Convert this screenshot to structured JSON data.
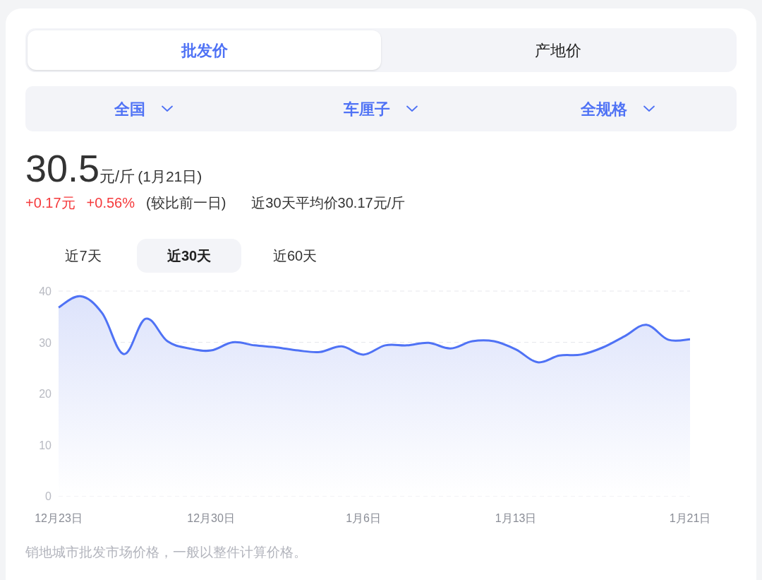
{
  "price_tabs": [
    {
      "label": "批发价",
      "selected": true
    },
    {
      "label": "产地价",
      "selected": false
    }
  ],
  "filters": [
    {
      "label": "全国"
    },
    {
      "label": "车厘子"
    },
    {
      "label": "全规格"
    }
  ],
  "price": {
    "value": "30.5",
    "unit": "元/斤",
    "date": "(1月21日)"
  },
  "change": {
    "amount": "+0.17元",
    "percent": "+0.56%",
    "note": "(较比前一日)",
    "average": "近30天平均价30.17元/斤"
  },
  "range_tabs": [
    {
      "label": "近7天",
      "selected": false
    },
    {
      "label": "近30天",
      "selected": true
    },
    {
      "label": "近60天",
      "selected": false
    }
  ],
  "chart_data": {
    "type": "area",
    "categories": [
      "12月23日",
      null,
      null,
      null,
      null,
      null,
      null,
      "12月30日",
      null,
      null,
      null,
      null,
      null,
      null,
      "1月6日",
      null,
      null,
      null,
      null,
      null,
      null,
      "1月13日",
      null,
      null,
      null,
      null,
      null,
      null,
      null,
      "1月21日"
    ],
    "series": [
      {
        "color": "#4f72f5",
        "values": [
          36.8,
          39.0,
          35.7,
          27.7,
          34.6,
          30.2,
          28.8,
          28.4,
          30.0,
          29.4,
          29.0,
          28.4,
          28.1,
          29.2,
          27.6,
          29.4,
          29.4,
          29.9,
          28.8,
          30.2,
          30.2,
          28.6,
          26.1,
          27.4,
          27.6,
          29.0,
          31.2,
          33.4,
          30.5,
          30.6
        ]
      }
    ],
    "ylim": [
      0,
      40
    ],
    "yticks": [
      0,
      10,
      20,
      30,
      40
    ]
  },
  "footnote": "销地城市批发市场价格，一般以整件计算价格。"
}
